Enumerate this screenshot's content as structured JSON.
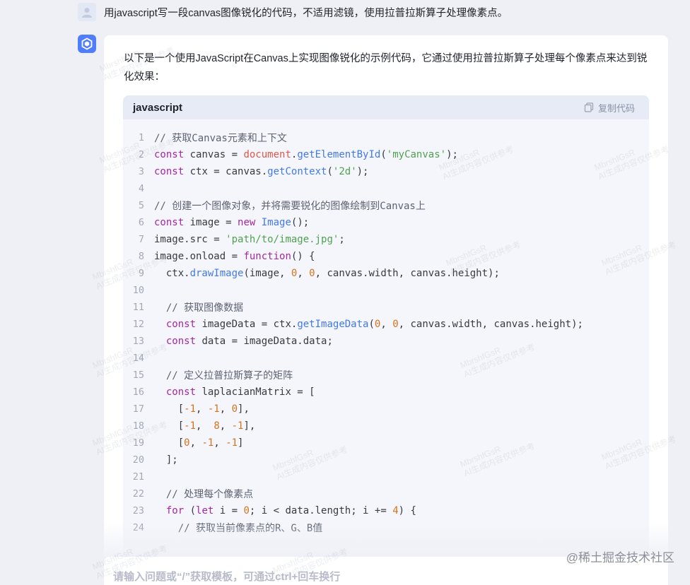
{
  "user_message": "用javascript写一段canvas图像锐化的代码，不适用滤镜，使用拉普拉斯算子处理像素点。",
  "answer": {
    "intro": "以下是一个使用JavaScript在Canvas上实现图像锐化的示例代码，它通过使用拉普拉斯算子处理每个像素点来达到锐化效果：",
    "code": {
      "language": "javascript",
      "copy_label": "复制代码",
      "lines": [
        [
          [
            "com",
            "// 获取Canvas元素和上下文"
          ]
        ],
        [
          [
            "kw",
            "const"
          ],
          [
            "pl",
            " canvas = "
          ],
          [
            "bi",
            "document"
          ],
          [
            "pl",
            "."
          ],
          [
            "fn",
            "getElementById"
          ],
          [
            "pl",
            "("
          ],
          [
            "str",
            "'myCanvas'"
          ],
          [
            "pl",
            ");"
          ]
        ],
        [
          [
            "kw",
            "const"
          ],
          [
            "pl",
            " ctx = canvas."
          ],
          [
            "fn",
            "getContext"
          ],
          [
            "pl",
            "("
          ],
          [
            "str",
            "'2d'"
          ],
          [
            "pl",
            ");"
          ]
        ],
        [],
        [
          [
            "com",
            "// 创建一个图像对象，并将需要锐化的图像绘制到Canvas上"
          ]
        ],
        [
          [
            "kw",
            "const"
          ],
          [
            "pl",
            " image = "
          ],
          [
            "kw",
            "new"
          ],
          [
            "pl",
            " "
          ],
          [
            "fn",
            "Image"
          ],
          [
            "pl",
            "();"
          ]
        ],
        [
          [
            "pl",
            "image.src = "
          ],
          [
            "str",
            "'path/to/image.jpg'"
          ],
          [
            "pl",
            ";"
          ]
        ],
        [
          [
            "pl",
            "image.onload = "
          ],
          [
            "kw",
            "function"
          ],
          [
            "pl",
            "() {"
          ]
        ],
        [
          [
            "pl",
            "  ctx."
          ],
          [
            "fn",
            "drawImage"
          ],
          [
            "pl",
            "(image, "
          ],
          [
            "num",
            "0"
          ],
          [
            "pl",
            ", "
          ],
          [
            "num",
            "0"
          ],
          [
            "pl",
            ", canvas.width, canvas.height);"
          ]
        ],
        [],
        [
          [
            "com",
            "  // 获取图像数据"
          ]
        ],
        [
          [
            "pl",
            "  "
          ],
          [
            "kw",
            "const"
          ],
          [
            "pl",
            " imageData = ctx."
          ],
          [
            "fn",
            "getImageData"
          ],
          [
            "pl",
            "("
          ],
          [
            "num",
            "0"
          ],
          [
            "pl",
            ", "
          ],
          [
            "num",
            "0"
          ],
          [
            "pl",
            ", canvas.width, canvas.height);"
          ]
        ],
        [
          [
            "pl",
            "  "
          ],
          [
            "kw",
            "const"
          ],
          [
            "pl",
            " data = imageData.data;"
          ]
        ],
        [],
        [
          [
            "com",
            "  // 定义拉普拉斯算子的矩阵"
          ]
        ],
        [
          [
            "pl",
            "  "
          ],
          [
            "kw",
            "const"
          ],
          [
            "pl",
            " laplacianMatrix = ["
          ]
        ],
        [
          [
            "pl",
            "    ["
          ],
          [
            "num",
            "-1"
          ],
          [
            "pl",
            ", "
          ],
          [
            "num",
            "-1"
          ],
          [
            "pl",
            ", "
          ],
          [
            "num",
            "0"
          ],
          [
            "pl",
            "],"
          ]
        ],
        [
          [
            "pl",
            "    ["
          ],
          [
            "num",
            "-1"
          ],
          [
            "pl",
            ",  "
          ],
          [
            "num",
            "8"
          ],
          [
            "pl",
            ", "
          ],
          [
            "num",
            "-1"
          ],
          [
            "pl",
            "],"
          ]
        ],
        [
          [
            "pl",
            "    ["
          ],
          [
            "num",
            "0"
          ],
          [
            "pl",
            ", "
          ],
          [
            "num",
            "-1"
          ],
          [
            "pl",
            ", "
          ],
          [
            "num",
            "-1"
          ],
          [
            "pl",
            "]"
          ]
        ],
        [
          [
            "pl",
            "  ];"
          ]
        ],
        [],
        [
          [
            "com",
            "  // 处理每个像素点"
          ]
        ],
        [
          [
            "pl",
            "  "
          ],
          [
            "kw",
            "for"
          ],
          [
            "pl",
            " ("
          ],
          [
            "kw",
            "let"
          ],
          [
            "pl",
            " i = "
          ],
          [
            "num",
            "0"
          ],
          [
            "pl",
            "; i < data.length; i += "
          ],
          [
            "num",
            "4"
          ],
          [
            "pl",
            ") {"
          ]
        ],
        [
          [
            "com",
            "    // 获取当前像素点的R、G、B值"
          ]
        ]
      ]
    }
  },
  "input": {
    "placeholder": "请输入问题或“/”获取模板，可通过ctrl+回车换行"
  },
  "watermark": "@稀土掘金技术社区",
  "overlay_watermark": [
    "MbrshfGsR",
    "AI生成内容仅供参考"
  ],
  "colors": {
    "accent": "#4f7dfb",
    "code_bg": "#f4f6fb",
    "code_header_bg": "#e7ebf6"
  }
}
